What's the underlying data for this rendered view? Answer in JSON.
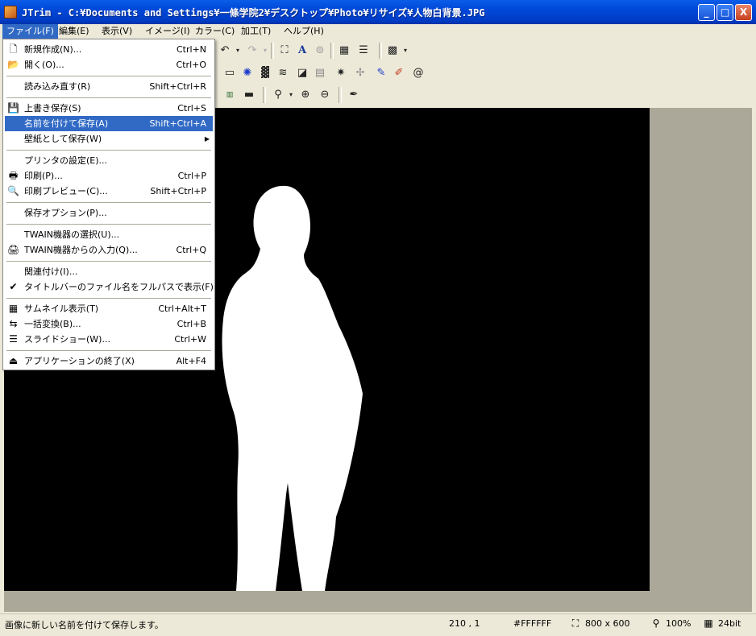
{
  "window": {
    "title": "JTrim - C:¥Documents and Settings¥一條学院2¥デスクトップ¥Photo¥リサイズ¥人物白背景.JPG",
    "controls": {
      "minimize": "_",
      "maximize": "□",
      "close": "X"
    }
  },
  "menubar": [
    {
      "label": "ファイル(F)",
      "active": true
    },
    {
      "label": "編集(E)"
    },
    {
      "label": "表示(V)"
    },
    {
      "label": "イメージ(I)"
    },
    {
      "label": "カラー(C)"
    },
    {
      "label": "加工(T)"
    },
    {
      "label": "ヘルプ(H)"
    }
  ],
  "file_menu": {
    "items": [
      {
        "label": "新規作成(N)...",
        "shortcut": "Ctrl+N",
        "icon": "new-file-icon",
        "glyph": "🗋"
      },
      {
        "label": "開く(O)...",
        "shortcut": "Ctrl+O",
        "icon": "open-folder-icon",
        "glyph": "📂"
      },
      {
        "label": "読み込み直す(R)",
        "shortcut": "Shift+Ctrl+R"
      },
      {
        "label": "上書き保存(S)",
        "shortcut": "Ctrl+S",
        "icon": "save-disk-icon",
        "glyph": "💾"
      },
      {
        "label": "名前を付けて保存(A)",
        "shortcut": "Shift+Ctrl+A",
        "highlighted": true
      },
      {
        "label": "壁紙として保存(W)",
        "submenu": true,
        "arrow": "▶"
      },
      {
        "label": "プリンタの設定(E)..."
      },
      {
        "label": "印刷(P)...",
        "shortcut": "Ctrl+P",
        "icon": "printer-icon",
        "glyph": "🖶"
      },
      {
        "label": "印刷プレビュー(C)...",
        "shortcut": "Shift+Ctrl+P",
        "icon": "print-preview-icon",
        "glyph": "🔍"
      },
      {
        "label": "保存オプション(P)..."
      },
      {
        "label": "TWAIN機器の選択(U)..."
      },
      {
        "label": "TWAIN機器からの入力(Q)...",
        "shortcut": "Ctrl+Q",
        "icon": "scanner-icon",
        "glyph": "🖨"
      },
      {
        "label": "関連付け(I)..."
      },
      {
        "label": "タイトルバーのファイル名をフルパスで表示(F)",
        "checked": true,
        "icon": "checkmark-icon",
        "glyph": "✔"
      },
      {
        "label": "サムネイル表示(T)",
        "shortcut": "Ctrl+Alt+T",
        "icon": "thumbnail-icon",
        "glyph": "▦"
      },
      {
        "label": "一括変換(B)...",
        "shortcut": "Ctrl+B",
        "icon": "batch-convert-icon",
        "glyph": "⇆"
      },
      {
        "label": "スライドショー(W)...",
        "shortcut": "Ctrl+W",
        "icon": "slideshow-icon",
        "glyph": "☰"
      },
      {
        "label": "アプリケーションの終了(X)",
        "shortcut": "Alt+F4",
        "icon": "exit-app-icon",
        "glyph": "⏏"
      }
    ]
  },
  "statusbar": {
    "message": "画像に新しい名前を付けて保存します。",
    "coords": "210 , 1",
    "color": "#FFFFFF",
    "size": "800 x 600",
    "zoom": "100%",
    "depth": "24bit"
  },
  "canvas": {
    "background": "#000000",
    "figure_color": "#FFFFFF"
  }
}
